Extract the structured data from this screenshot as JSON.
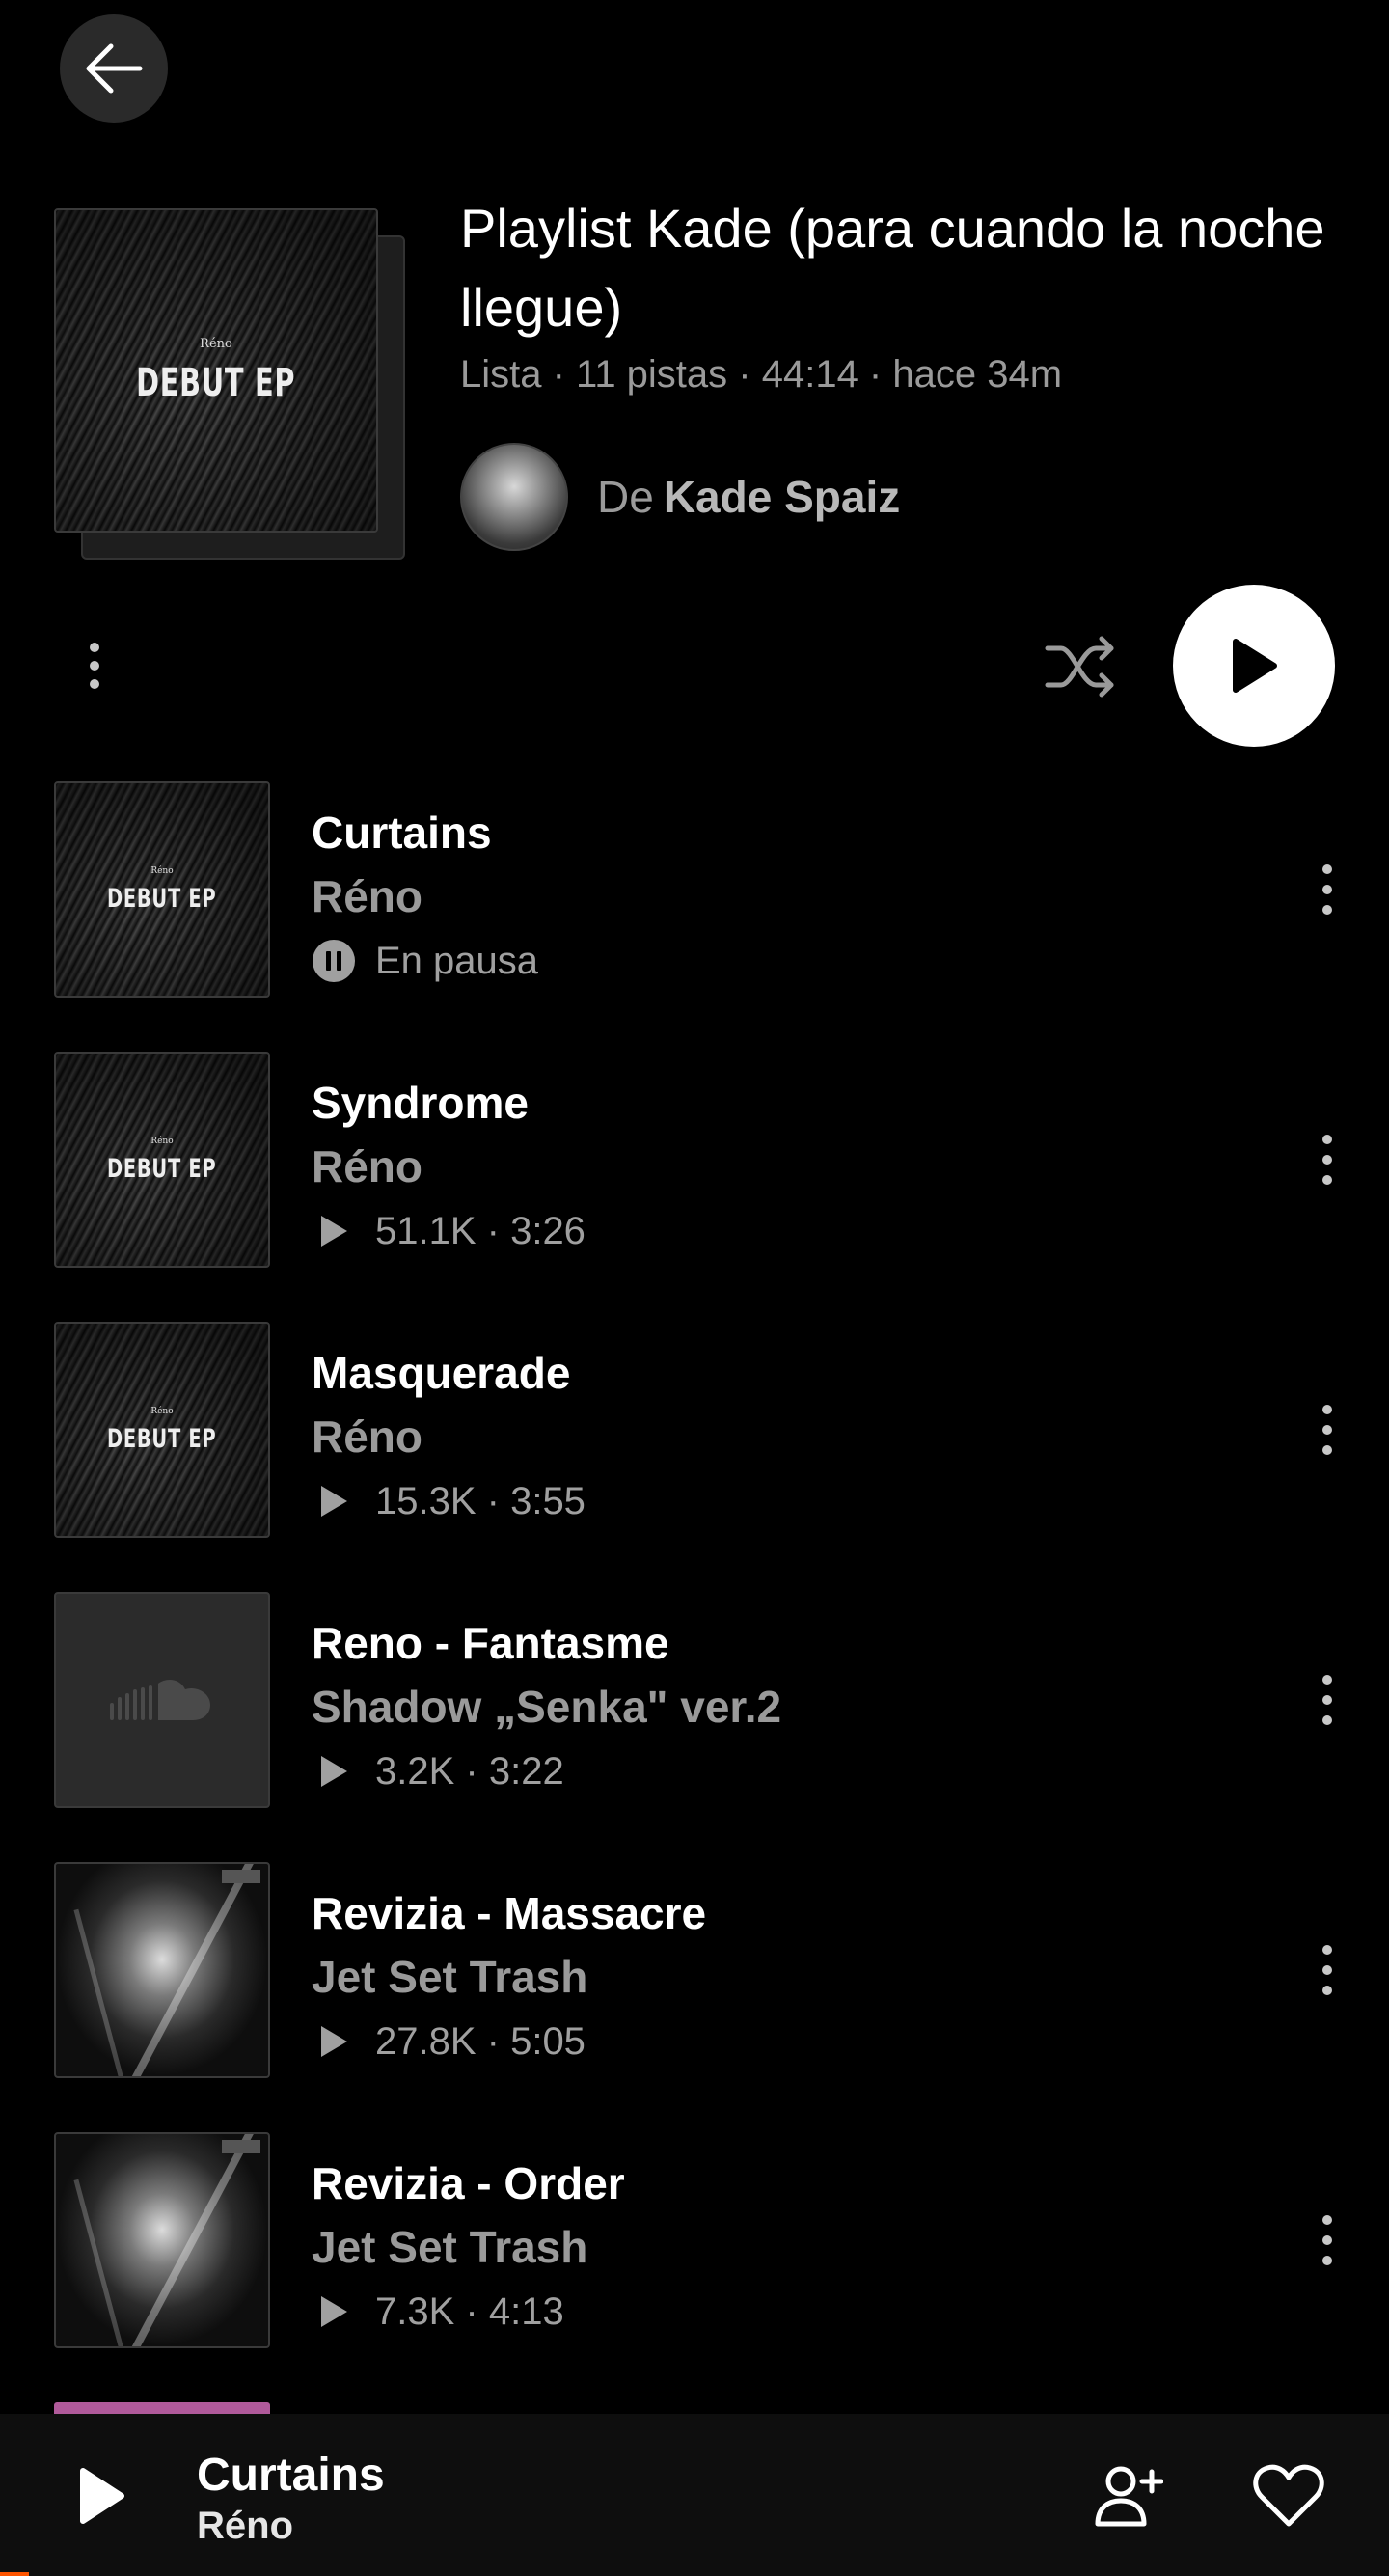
{
  "header": {
    "back_icon": "arrow-left-icon"
  },
  "playlist": {
    "cover": {
      "artist_text": "Réno",
      "title_text": "DEBUT EP"
    },
    "title": "Playlist Kade (para cuando la noche llegue)",
    "meta": "Lista · 11 pistas · 44:14 · hace 34m",
    "owner_prefix": "De",
    "owner_name": "Kade Spaiz"
  },
  "actions": {
    "more_icon": "more-vertical-icon",
    "shuffle_icon": "shuffle-icon",
    "play_icon": "play-icon"
  },
  "tracks": [
    {
      "title": "Curtains",
      "artist": "Réno",
      "stats": "En pausa",
      "stats_icon": "pause-circle-icon",
      "art": "debut-ep"
    },
    {
      "title": "Syndrome",
      "artist": "Réno",
      "stats": "51.1K · 3:26",
      "stats_icon": "play-icon",
      "art": "debut-ep"
    },
    {
      "title": "Masquerade",
      "artist": "Réno",
      "stats": "15.3K · 3:55",
      "stats_icon": "play-icon",
      "art": "debut-ep"
    },
    {
      "title": "Reno - Fantasme",
      "artist": "Shadow „Senka\" ver.2",
      "stats": "3.2K · 3:22",
      "stats_icon": "play-icon",
      "art": "soundcloud-placeholder"
    },
    {
      "title": "Revizia - Massacre",
      "artist": "Jet Set Trash",
      "stats": "27.8K · 5:05",
      "stats_icon": "play-icon",
      "art": "dark-artwork"
    },
    {
      "title": "Revizia - Order",
      "artist": "Jet Set Trash",
      "stats": "7.3K · 4:13",
      "stats_icon": "play-icon",
      "art": "dark-artwork"
    }
  ],
  "mini_player": {
    "title": "Curtains",
    "artist": "Réno",
    "play_icon": "play-icon",
    "follow_icon": "add-user-icon",
    "like_icon": "heart-icon"
  },
  "colors": {
    "background": "#000000",
    "accent": "#ff5500",
    "secondary_text": "#9a9a9a"
  }
}
